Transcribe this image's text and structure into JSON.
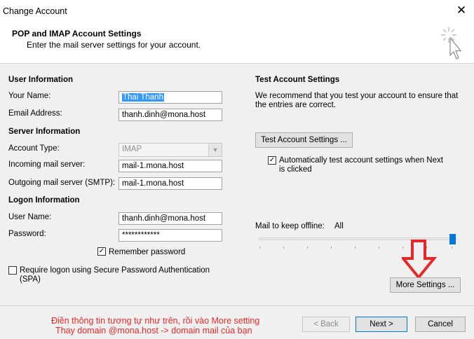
{
  "window": {
    "title": "Change Account",
    "close_glyph": "✕"
  },
  "header": {
    "title": "POP and IMAP Account Settings",
    "subtitle": "Enter the mail server settings for your account.",
    "icon": "wizard-cursor-icon"
  },
  "user_info": {
    "section": "User Information",
    "name_label": "Your Name:",
    "name_value": "Thai Thanh",
    "email_label": "Email Address:",
    "email_value": "thanh.dinh@mona.host"
  },
  "server_info": {
    "section": "Server Information",
    "account_type_label": "Account Type:",
    "account_type_value": "IMAP",
    "incoming_label": "Incoming mail server:",
    "incoming_value": "mail-1.mona.host",
    "outgoing_label": "Outgoing mail server (SMTP):",
    "outgoing_value": "mail-1.mona.host"
  },
  "logon_info": {
    "section": "Logon Information",
    "username_label": "User Name:",
    "username_value": "thanh.dinh@mona.host",
    "password_label": "Password:",
    "password_value": "************",
    "remember_label": "Remember password",
    "remember_checked": true,
    "spa_label_line1": "Require logon using Secure Password Authentication",
    "spa_label_line2": "(SPA)",
    "spa_checked": false
  },
  "test_settings": {
    "section": "Test Account Settings",
    "desc_line1": "We recommend that you test your account to ensure that",
    "desc_line2": "the entries are correct.",
    "test_button": "Test Account Settings ...",
    "auto_test_line1": "Automatically test account settings when Next",
    "auto_test_line2": "is clicked",
    "auto_test_checked": true,
    "offline_label": "Mail to keep offline:",
    "offline_value": "All",
    "offline_slider_level": 1.0,
    "more_settings_button": "More Settings ..."
  },
  "annotation": {
    "line1": "Điền thông tin tương tự như trên, rồi vào More setting",
    "line2": "Thay domain @mona.host -> domain mail của bạn",
    "color": "#e62828",
    "arrow_icon": "red-down-arrow-icon"
  },
  "footer": {
    "back_button": "< Back",
    "next_button": "Next >",
    "cancel_button": "Cancel"
  }
}
